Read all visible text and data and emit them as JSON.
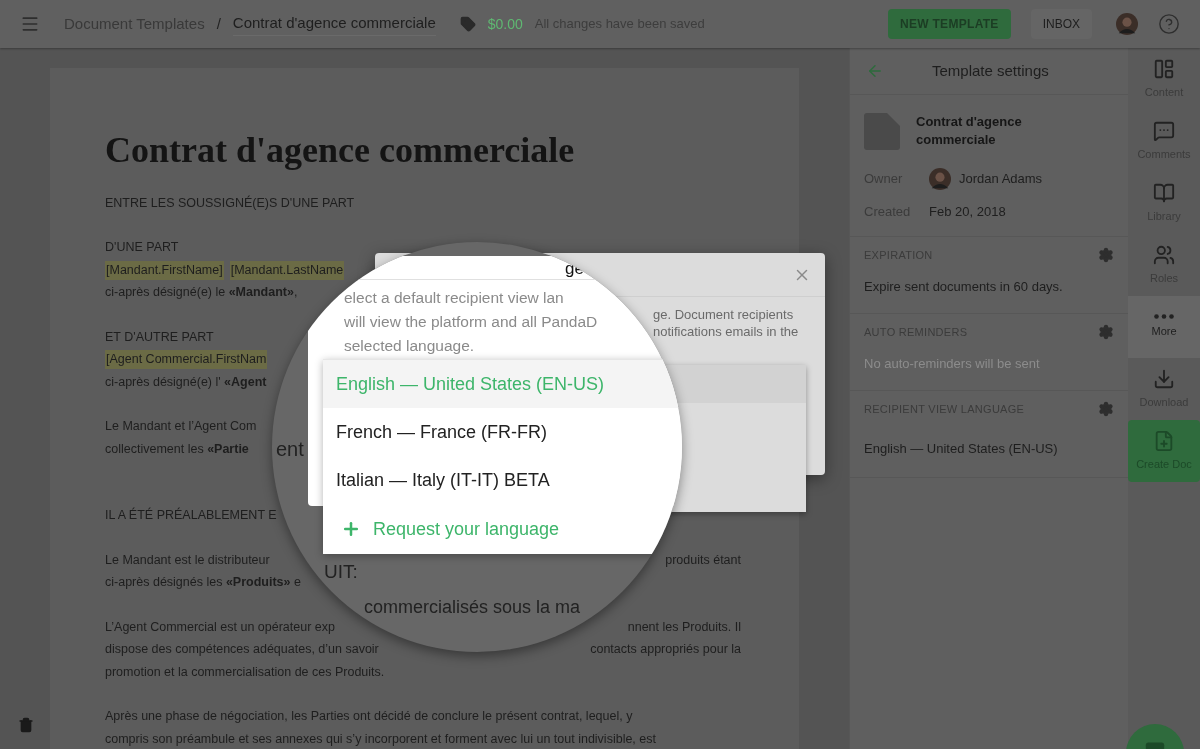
{
  "topbar": {
    "breadcrumb_root": "Document Templates",
    "separator": "/",
    "title": "Contrat d'agence commerciale",
    "price": "$0.00",
    "save_status": "All changes have been saved",
    "new_template_button": "NEW TEMPLATE",
    "inbox_button": "INBOX"
  },
  "document": {
    "title": "Contrat d'agence commerciale",
    "paragraphs": [
      {
        "kind": "normal",
        "lines": [
          {
            "left": "ENTRE LES SOUSSIGNÉ(E)S D'UNE PART"
          }
        ]
      },
      {
        "kind": "normal",
        "lines": [
          {
            "left": "D'UNE PART"
          },
          {
            "fields": [
              "[Mandant.FirstName]",
              "[Mandant.LastName"
            ]
          },
          {
            "left": "ci-après désigné(e) le **«Mandant»**,"
          }
        ]
      },
      {
        "kind": "normal",
        "lines": [
          {
            "left": "ET D'AUTRE PART"
          },
          {
            "fields": [
              "[Agent Commercial.FirstNam"
            ]
          },
          {
            "left": "ci-après désigné(e) l' **«Agent**"
          }
        ]
      },
      {
        "kind": "normal",
        "lines": [
          {
            "left": "Le Mandant et l’Agent Com"
          },
          {
            "left": "collectivement les **«Partie**"
          }
        ]
      },
      {
        "kind": "section",
        "lines": [
          {
            "left": "IL A ÉTÉ PRÉALABLEMENT E"
          }
        ]
      },
      {
        "kind": "normal",
        "lines": [
          {
            "left": "Le Mandant est le distributeur",
            "right": "produits étant"
          },
          {
            "left": "ci-après désignés les **«Produits»** e"
          }
        ]
      },
      {
        "kind": "normal",
        "lines": [
          {
            "left": "L’Agent Commercial est un opérateur exp",
            "right": "nnent les Produits. Il"
          },
          {
            "left": "dispose des compétences adéquates, d’un savoir",
            "right": "contacts appropriés pour la"
          },
          {
            "left": "promotion et la commercialisation de ces Produits."
          }
        ]
      },
      {
        "kind": "normal",
        "lines": [
          {
            "left": "Après une phase de négociation, les Parties ont décidé de conclure le présent contrat, lequel, y"
          },
          {
            "left": "compris son préambule et ses annexes qui s’y incorporent et forment avec lui un tout indivisible, est"
          }
        ]
      }
    ]
  },
  "modal": {
    "description_lines": [
      "ge. Document recipients",
      "notifications emails in the"
    ]
  },
  "magnifier": {
    "heading_fragment": "ge",
    "description_lines": [
      "elect a default recipient view lan",
      "will view the platform and all PandaD",
      "selected language."
    ],
    "options": [
      {
        "label": "English — United States (EN-US)",
        "selected": true
      },
      {
        "label": "French — France (FR-FR)",
        "selected": false
      },
      {
        "label": "Italian — Italy (IT-IT) BETA",
        "selected": false
      }
    ],
    "request_option": "Request your language",
    "background_fragments": [
      "ent",
      "UIT:",
      "commercialisés sous la ma"
    ]
  },
  "sidebar": {
    "title": "Template settings",
    "doc_name": "Contrat d'agence commerciale",
    "owner_label": "Owner",
    "owner": "Jordan Adams",
    "created_label": "Created",
    "created": "Feb 20, 2018",
    "sections": [
      {
        "heading": "EXPIRATION",
        "value": "Expire sent documents in 60 days.",
        "disabled": false
      },
      {
        "heading": "AUTO REMINDERS",
        "value": "No auto-reminders will be sent",
        "disabled": true
      },
      {
        "heading": "RECIPIENT VIEW LANGUAGE",
        "value": "English — United States (EN-US)",
        "disabled": false
      }
    ]
  },
  "rail": [
    {
      "label": "Content",
      "kind": "content",
      "selected": false
    },
    {
      "label": "Comments",
      "kind": "comments",
      "selected": false
    },
    {
      "label": "Library",
      "kind": "library",
      "selected": false
    },
    {
      "label": "Roles",
      "kind": "roles",
      "selected": false
    },
    {
      "label": "More",
      "kind": "more",
      "selected": true
    },
    {
      "label": "Download",
      "kind": "download",
      "selected": false
    },
    {
      "label": "Create Doc",
      "kind": "create",
      "selected": false
    }
  ]
}
